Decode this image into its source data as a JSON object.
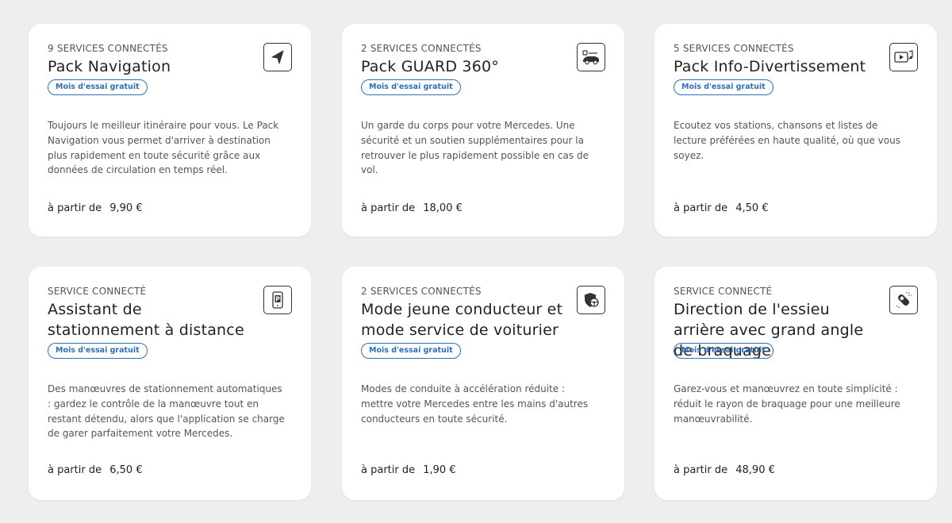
{
  "price_prefix": "à partir de",
  "badge_label": "Mois d'essai gratuit",
  "cards": [
    {
      "eyebrow": "9 SERVICES CONNECTÉS",
      "title": "Pack Navigation",
      "badge": "Mois d'essai gratuit",
      "description": "Toujours le meilleur itinéraire pour vous. Le Pack Navigation vous permet d'arriver à destination plus rapidement en toute sécurité grâce aux données de circulation en temps réel.",
      "price_prefix": "à partir de",
      "price": "9,90 €",
      "icon": "navigation-arrow-icon"
    },
    {
      "eyebrow": "2 SERVICES CONNECTÉS",
      "title": "Pack GUARD 360°",
      "badge": "Mois d'essai gratuit",
      "description": "Un garde du corps pour votre Mercedes. Une sécurité et un soutien supplémentaires pour la retrouver le plus rapidement possible en cas de vol.",
      "price_prefix": "à partir de",
      "price": "18,00 €",
      "icon": "car-guard-icon"
    },
    {
      "eyebrow": "5 SERVICES CONNECTÉS",
      "title": "Pack Info-Divertissement",
      "badge": "Mois d'essai gratuit",
      "description": "Ecoutez vos stations, chansons et listes de lecture préférées en haute qualité, où que vous soyez.",
      "price_prefix": "à partir de",
      "price": "4,50 €",
      "icon": "media-music-icon"
    },
    {
      "eyebrow": "SERVICE CONNECTÉ",
      "title": "Assistant de stationnement à distance",
      "badge": "Mois d'essai gratuit",
      "description": "Des manœuvres de stationnement automatiques : gardez le contrôle de la manœuvre tout en restant détendu, alors que l'application se charge de garer parfaitement votre Mercedes.",
      "price_prefix": "à partir de",
      "price": "6,50 €",
      "icon": "phone-parking-icon"
    },
    {
      "eyebrow": "2 SERVICES CONNECTÉS",
      "title": "Mode jeune conducteur et mode service de voiturier",
      "badge": "Mois d'essai gratuit",
      "description": "Modes de conduite à accélération réduite : mettre votre Mercedes entre les mains d'autres conducteurs en toute sécurité.",
      "price_prefix": "à partir de",
      "price": "1,90 €",
      "icon": "shield-steering-icon"
    },
    {
      "eyebrow": "SERVICE CONNECTÉ",
      "title": "Direction de l'essieu arrière avec grand angle de braquage",
      "badge": "Mois d'essai gratuit",
      "description": "Garez-vous et manœuvrez en toute simplicité : réduit le rayon de braquage pour une meilleure manœuvrabilité.",
      "price_prefix": "à partir de",
      "price": "48,90 €",
      "icon": "rear-axle-steering-icon"
    }
  ]
}
